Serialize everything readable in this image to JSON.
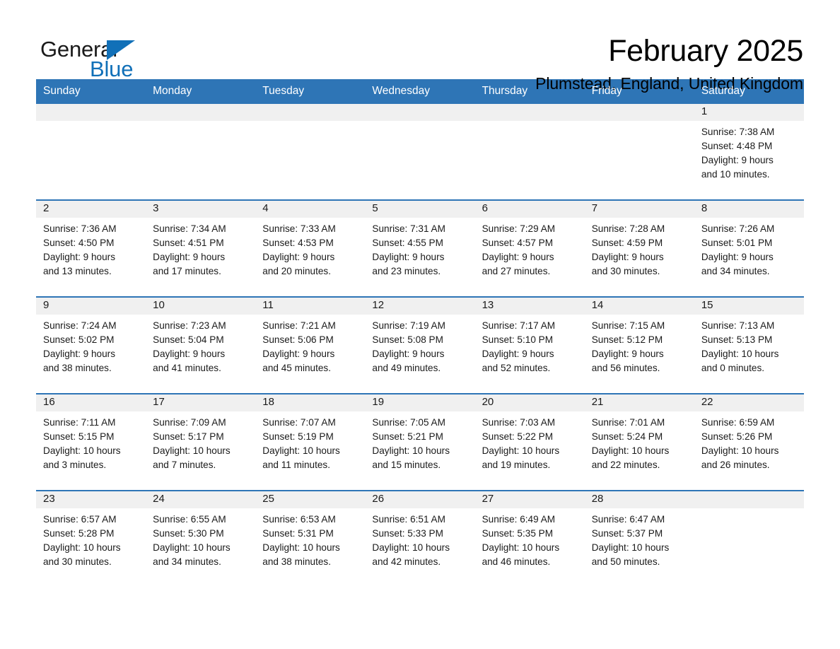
{
  "logo": {
    "text_primary": "General",
    "text_secondary": "Blue",
    "primary_color": "#1a1a1a",
    "secondary_color": "#1170b8",
    "triangle_icon": "triangle-icon"
  },
  "header": {
    "title": "February 2025",
    "location": "Plumstead, England, United Kingdom"
  },
  "theme": {
    "header_blue": "#2e75b6",
    "row_divider_blue": "#2e75b6",
    "day_band_gray": "#f0f0f0",
    "text_color": "#1a1a1a",
    "background": "#ffffff"
  },
  "calendar": {
    "weekdays": [
      "Sunday",
      "Monday",
      "Tuesday",
      "Wednesday",
      "Thursday",
      "Friday",
      "Saturday"
    ],
    "labels": {
      "sunrise": "Sunrise:",
      "sunset": "Sunset:",
      "daylight": "Daylight:"
    },
    "weeks": [
      [
        {
          "day": "",
          "empty": true
        },
        {
          "day": "",
          "empty": true
        },
        {
          "day": "",
          "empty": true
        },
        {
          "day": "",
          "empty": true
        },
        {
          "day": "",
          "empty": true
        },
        {
          "day": "",
          "empty": true
        },
        {
          "day": "1",
          "sunrise": "Sunrise: 7:38 AM",
          "sunset": "Sunset: 4:48 PM",
          "daylight_line1": "Daylight: 9 hours",
          "daylight_line2": "and 10 minutes."
        }
      ],
      [
        {
          "day": "2",
          "sunrise": "Sunrise: 7:36 AM",
          "sunset": "Sunset: 4:50 PM",
          "daylight_line1": "Daylight: 9 hours",
          "daylight_line2": "and 13 minutes."
        },
        {
          "day": "3",
          "sunrise": "Sunrise: 7:34 AM",
          "sunset": "Sunset: 4:51 PM",
          "daylight_line1": "Daylight: 9 hours",
          "daylight_line2": "and 17 minutes."
        },
        {
          "day": "4",
          "sunrise": "Sunrise: 7:33 AM",
          "sunset": "Sunset: 4:53 PM",
          "daylight_line1": "Daylight: 9 hours",
          "daylight_line2": "and 20 minutes."
        },
        {
          "day": "5",
          "sunrise": "Sunrise: 7:31 AM",
          "sunset": "Sunset: 4:55 PM",
          "daylight_line1": "Daylight: 9 hours",
          "daylight_line2": "and 23 minutes."
        },
        {
          "day": "6",
          "sunrise": "Sunrise: 7:29 AM",
          "sunset": "Sunset: 4:57 PM",
          "daylight_line1": "Daylight: 9 hours",
          "daylight_line2": "and 27 minutes."
        },
        {
          "day": "7",
          "sunrise": "Sunrise: 7:28 AM",
          "sunset": "Sunset: 4:59 PM",
          "daylight_line1": "Daylight: 9 hours",
          "daylight_line2": "and 30 minutes."
        },
        {
          "day": "8",
          "sunrise": "Sunrise: 7:26 AM",
          "sunset": "Sunset: 5:01 PM",
          "daylight_line1": "Daylight: 9 hours",
          "daylight_line2": "and 34 minutes."
        }
      ],
      [
        {
          "day": "9",
          "sunrise": "Sunrise: 7:24 AM",
          "sunset": "Sunset: 5:02 PM",
          "daylight_line1": "Daylight: 9 hours",
          "daylight_line2": "and 38 minutes."
        },
        {
          "day": "10",
          "sunrise": "Sunrise: 7:23 AM",
          "sunset": "Sunset: 5:04 PM",
          "daylight_line1": "Daylight: 9 hours",
          "daylight_line2": "and 41 minutes."
        },
        {
          "day": "11",
          "sunrise": "Sunrise: 7:21 AM",
          "sunset": "Sunset: 5:06 PM",
          "daylight_line1": "Daylight: 9 hours",
          "daylight_line2": "and 45 minutes."
        },
        {
          "day": "12",
          "sunrise": "Sunrise: 7:19 AM",
          "sunset": "Sunset: 5:08 PM",
          "daylight_line1": "Daylight: 9 hours",
          "daylight_line2": "and 49 minutes."
        },
        {
          "day": "13",
          "sunrise": "Sunrise: 7:17 AM",
          "sunset": "Sunset: 5:10 PM",
          "daylight_line1": "Daylight: 9 hours",
          "daylight_line2": "and 52 minutes."
        },
        {
          "day": "14",
          "sunrise": "Sunrise: 7:15 AM",
          "sunset": "Sunset: 5:12 PM",
          "daylight_line1": "Daylight: 9 hours",
          "daylight_line2": "and 56 minutes."
        },
        {
          "day": "15",
          "sunrise": "Sunrise: 7:13 AM",
          "sunset": "Sunset: 5:13 PM",
          "daylight_line1": "Daylight: 10 hours",
          "daylight_line2": "and 0 minutes."
        }
      ],
      [
        {
          "day": "16",
          "sunrise": "Sunrise: 7:11 AM",
          "sunset": "Sunset: 5:15 PM",
          "daylight_line1": "Daylight: 10 hours",
          "daylight_line2": "and 3 minutes."
        },
        {
          "day": "17",
          "sunrise": "Sunrise: 7:09 AM",
          "sunset": "Sunset: 5:17 PM",
          "daylight_line1": "Daylight: 10 hours",
          "daylight_line2": "and 7 minutes."
        },
        {
          "day": "18",
          "sunrise": "Sunrise: 7:07 AM",
          "sunset": "Sunset: 5:19 PM",
          "daylight_line1": "Daylight: 10 hours",
          "daylight_line2": "and 11 minutes."
        },
        {
          "day": "19",
          "sunrise": "Sunrise: 7:05 AM",
          "sunset": "Sunset: 5:21 PM",
          "daylight_line1": "Daylight: 10 hours",
          "daylight_line2": "and 15 minutes."
        },
        {
          "day": "20",
          "sunrise": "Sunrise: 7:03 AM",
          "sunset": "Sunset: 5:22 PM",
          "daylight_line1": "Daylight: 10 hours",
          "daylight_line2": "and 19 minutes."
        },
        {
          "day": "21",
          "sunrise": "Sunrise: 7:01 AM",
          "sunset": "Sunset: 5:24 PM",
          "daylight_line1": "Daylight: 10 hours",
          "daylight_line2": "and 22 minutes."
        },
        {
          "day": "22",
          "sunrise": "Sunrise: 6:59 AM",
          "sunset": "Sunset: 5:26 PM",
          "daylight_line1": "Daylight: 10 hours",
          "daylight_line2": "and 26 minutes."
        }
      ],
      [
        {
          "day": "23",
          "sunrise": "Sunrise: 6:57 AM",
          "sunset": "Sunset: 5:28 PM",
          "daylight_line1": "Daylight: 10 hours",
          "daylight_line2": "and 30 minutes."
        },
        {
          "day": "24",
          "sunrise": "Sunrise: 6:55 AM",
          "sunset": "Sunset: 5:30 PM",
          "daylight_line1": "Daylight: 10 hours",
          "daylight_line2": "and 34 minutes."
        },
        {
          "day": "25",
          "sunrise": "Sunrise: 6:53 AM",
          "sunset": "Sunset: 5:31 PM",
          "daylight_line1": "Daylight: 10 hours",
          "daylight_line2": "and 38 minutes."
        },
        {
          "day": "26",
          "sunrise": "Sunrise: 6:51 AM",
          "sunset": "Sunset: 5:33 PM",
          "daylight_line1": "Daylight: 10 hours",
          "daylight_line2": "and 42 minutes."
        },
        {
          "day": "27",
          "sunrise": "Sunrise: 6:49 AM",
          "sunset": "Sunset: 5:35 PM",
          "daylight_line1": "Daylight: 10 hours",
          "daylight_line2": "and 46 minutes."
        },
        {
          "day": "28",
          "sunrise": "Sunrise: 6:47 AM",
          "sunset": "Sunset: 5:37 PM",
          "daylight_line1": "Daylight: 10 hours",
          "daylight_line2": "and 50 minutes."
        },
        {
          "day": "",
          "empty": true
        }
      ]
    ]
  }
}
